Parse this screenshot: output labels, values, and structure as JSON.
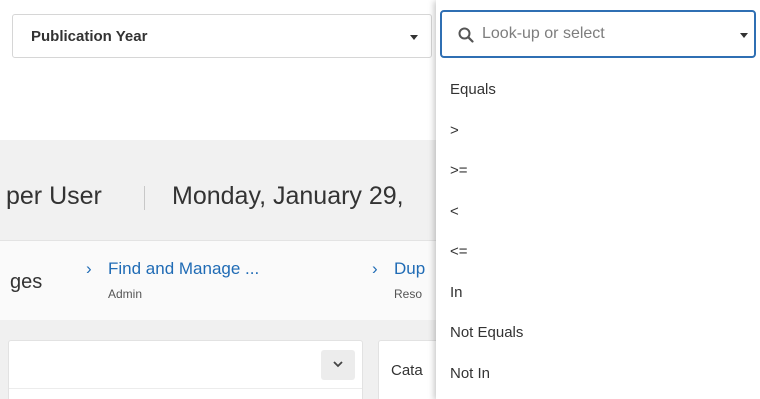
{
  "filter": {
    "field_value": "Publication Year",
    "lookup_placeholder": "Look-up or select",
    "operators": [
      "Equals",
      ">",
      ">=",
      "<",
      "<=",
      "In",
      "Not Equals",
      "Not In"
    ]
  },
  "header": {
    "user_name_partial": "per User",
    "date_partial": "Monday, January 29,"
  },
  "links": {
    "cut_text": "ges",
    "items": [
      {
        "title": "Find and Manage ...",
        "subtitle": "Admin"
      },
      {
        "title": "Dup",
        "subtitle": "Reso"
      }
    ]
  },
  "cards": {
    "right_title_partial": "Cata"
  },
  "icons": {
    "lookup": "search-icon",
    "collapse": "chevron-down-icon",
    "link": "chevron-right-icon"
  },
  "colors": {
    "accent": "#2f6fb3",
    "link": "#1f6bb5"
  }
}
